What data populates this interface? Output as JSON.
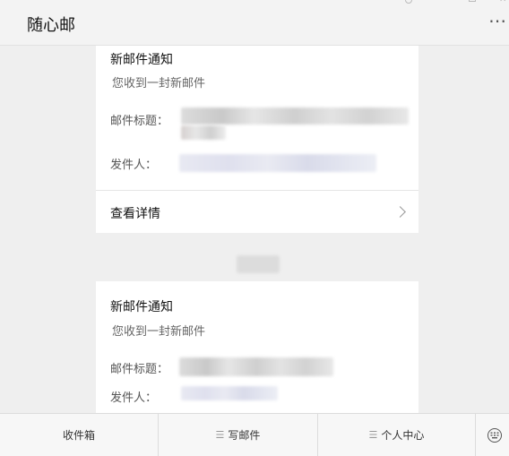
{
  "app": {
    "title": "随心邮"
  },
  "cards": [
    {
      "title": "新邮件通知",
      "subtitle": "您收到一封新邮件",
      "subject_label": "邮件标题：",
      "sender_label": "发件人：",
      "details_label": "查看详情"
    },
    {
      "title": "新邮件通知",
      "subtitle": "您收到一封新邮件",
      "subject_label": "邮件标题：",
      "sender_label": "发件人："
    }
  ],
  "tabs": [
    {
      "label": "收件箱"
    },
    {
      "label": "写邮件"
    },
    {
      "label": "个人中心"
    }
  ],
  "icons": {
    "more": "more-icon",
    "chevron": "chevron-right-icon",
    "menu": "menu-icon",
    "keyboard": "keyboard-icon"
  },
  "colors": {
    "background": "#efefef",
    "card": "#ffffff",
    "tabbar": "#f7f7f7"
  }
}
